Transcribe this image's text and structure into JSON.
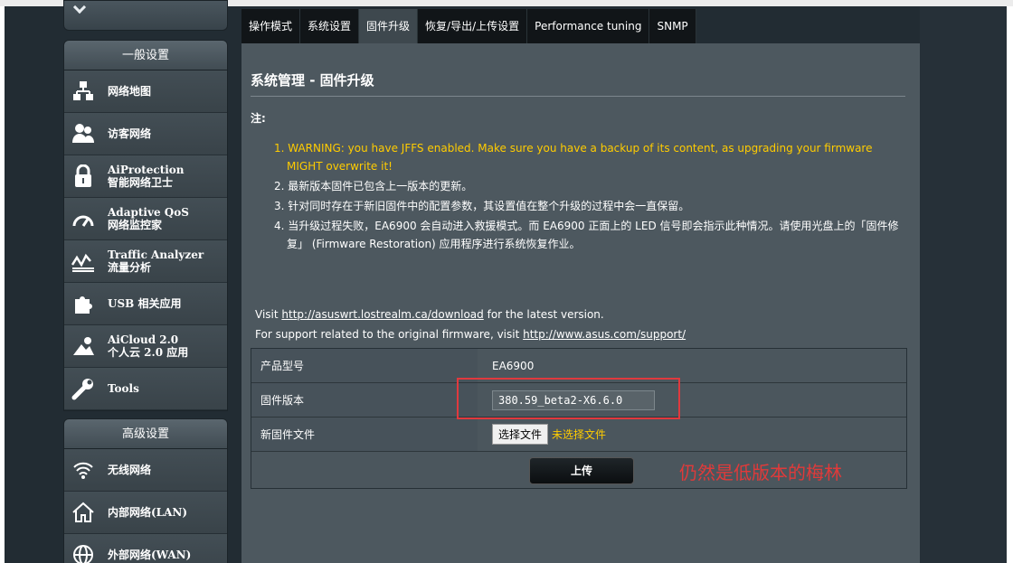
{
  "sidebar": {
    "general_header": "一般设置",
    "general_items": [
      {
        "label": "网络地图",
        "sub": "",
        "icon": "network-map-icon"
      },
      {
        "label": "访客网络",
        "sub": "",
        "icon": "guest-network-icon"
      },
      {
        "label": "AiProtection",
        "sub": "智能网络卫士",
        "icon": "lock-icon"
      },
      {
        "label": "Adaptive QoS",
        "sub": "网络监控家",
        "icon": "gauge-icon"
      },
      {
        "label": "Traffic Analyzer",
        "sub": "流量分析",
        "icon": "traffic-chart-icon"
      },
      {
        "label": "USB 相关应用",
        "sub": "",
        "icon": "puzzle-icon"
      },
      {
        "label": "AiCloud 2.0",
        "sub": "个人云 2.0 应用",
        "icon": "cloud-icon"
      },
      {
        "label": "Tools",
        "sub": "",
        "icon": "wrench-icon"
      }
    ],
    "advanced_header": "高级设置",
    "advanced_items": [
      {
        "label": "无线网络",
        "icon": "wifi-icon"
      },
      {
        "label": "内部网络(LAN)",
        "icon": "home-icon"
      },
      {
        "label": "外部网络(WAN)",
        "icon": "globe-icon"
      }
    ]
  },
  "tabs": [
    {
      "label": "操作模式",
      "active": false
    },
    {
      "label": "系统设置",
      "active": false
    },
    {
      "label": "固件升级",
      "active": true
    },
    {
      "label": "恢复/导出/上传设置",
      "active": false
    },
    {
      "label": "Performance tuning",
      "active": false
    },
    {
      "label": "SNMP",
      "active": false
    }
  ],
  "main": {
    "title": "系统管理 - 固件升级",
    "note_label": "注:",
    "notes": [
      "1. WARNING: you have JFFS enabled. Make sure you have a backup of its content, as upgrading your firmware MIGHT overwrite it!",
      "2. 最新版本固件已包含上一版本的更新。",
      "3. 针对同时存在于新旧固件中的配置参数，其设置值在整个升级的过程中会一直保留。",
      "4. 当升级过程失败，EA6900 会自动进入救援模式。而 EA6900 正面上的 LED 信号即会指示此种情况。请使用光盘上的「固件修复」 (Firmware Restoration) 应用程序进行系统恢复作业。"
    ],
    "visit_prefix": "Visit ",
    "visit_link": "http://asuswrt.lostrealm.ca/download",
    "visit_suffix": " for the latest version.",
    "support_prefix": "For support related to the original firmware, visit ",
    "support_link": "http://www.asus.com/support/",
    "rows": {
      "model_label": "产品型号",
      "model_value": "EA6900",
      "fw_label": "固件版本",
      "fw_value": "380.59_beta2-X6.6.0",
      "file_label": "新固件文件",
      "file_button": "选择文件",
      "file_status": "未选择文件"
    },
    "upload_button": "上传",
    "annotation": "仍然是低版本的梅林"
  },
  "colors": {
    "warning": "#ffcc00",
    "annotation_red": "#e03a3a"
  }
}
